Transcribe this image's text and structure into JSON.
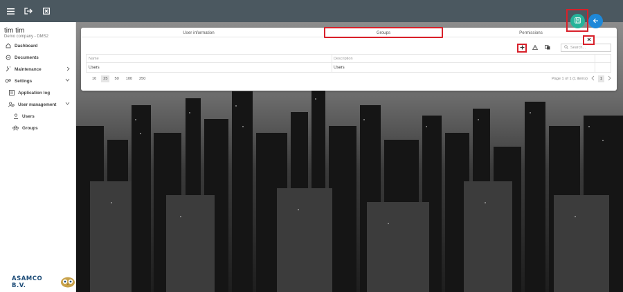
{
  "topbar": {
    "icons": [
      "menu-icon",
      "logout-icon",
      "close-window-icon"
    ]
  },
  "user": {
    "name": "tim tim",
    "company": "Demo company - DMS2"
  },
  "sidebar": {
    "items": [
      {
        "label": "Dashboard",
        "icon": "home-icon"
      },
      {
        "label": "Documents",
        "icon": "document-icon"
      },
      {
        "label": "Maintenance",
        "icon": "wrench-icon"
      },
      {
        "label": "Settings",
        "icon": "gears-icon"
      },
      {
        "label": "Application log",
        "icon": "log-icon"
      },
      {
        "label": "User management",
        "icon": "users-manage-icon"
      },
      {
        "label": "Users",
        "icon": "user-icon"
      },
      {
        "label": "Groups",
        "icon": "group-icon"
      }
    ],
    "brand": "ASAMCO B.V."
  },
  "tabs": [
    {
      "label": "User information"
    },
    {
      "label": "Groups",
      "active": true
    },
    {
      "label": "Permissions"
    }
  ],
  "toolbar": {
    "search_placeholder": "Search..."
  },
  "grid": {
    "columns": [
      "Name",
      "Description"
    ],
    "rows": [
      {
        "name": "Users",
        "description": "Users"
      }
    ]
  },
  "pagination": {
    "sizes": [
      "10",
      "25",
      "50",
      "100",
      "250"
    ],
    "selected_size": "25",
    "info": "Page 1 of 1 (1 items)",
    "current_page": "1"
  },
  "colors": {
    "topbar": "#4b5860",
    "save_fab": "#26b39a",
    "back_fab": "#1e88d8",
    "highlight": "#d8202a"
  }
}
